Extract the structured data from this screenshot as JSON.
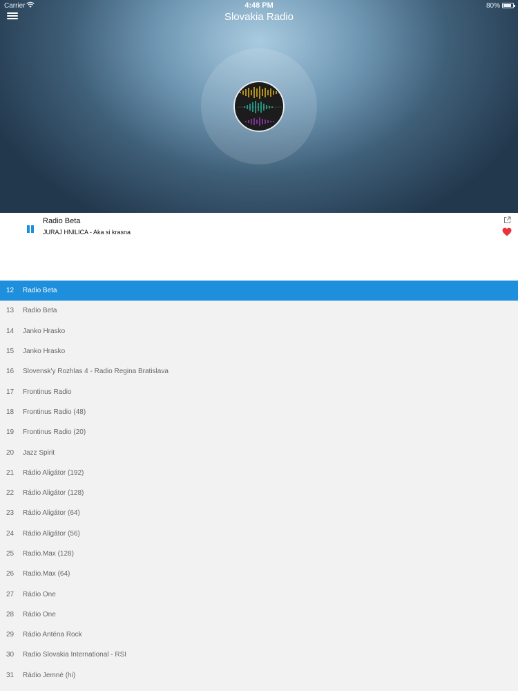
{
  "status_bar": {
    "carrier": "Carrier",
    "time": "4:48 PM",
    "battery": "80%"
  },
  "header": {
    "title": "Slovakia Radio",
    "menu_icon": "hamburger-menu-icon"
  },
  "now_playing": {
    "station": "Radio Beta",
    "track": "JURAJ HNILICA - Aka si krasna",
    "accent_color": "#1d8fdc",
    "favorite_color": "#e8343f"
  },
  "stations": [
    {
      "num": "12",
      "name": "Radio Beta",
      "active": true
    },
    {
      "num": "13",
      "name": "Radio Beta"
    },
    {
      "num": "14",
      "name": "Janko Hrasko"
    },
    {
      "num": "15",
      "name": "Janko Hrasko"
    },
    {
      "num": "16",
      "name": "Slovensk'y Rozhlas 4 - Radio Regina Bratislava"
    },
    {
      "num": "17",
      "name": "Frontinus Radio"
    },
    {
      "num": "18",
      "name": "Frontinus Radio (48)"
    },
    {
      "num": "19",
      "name": "Frontinus Radio (20)"
    },
    {
      "num": "20",
      "name": "Jazz Spirit"
    },
    {
      "num": "21",
      "name": "Rádio Aligátor (192)"
    },
    {
      "num": "22",
      "name": "Rádio Aligátor (128)"
    },
    {
      "num": "23",
      "name": "Rádio Aligátor (64)"
    },
    {
      "num": "24",
      "name": "Rádio Aligátor (56)"
    },
    {
      "num": "25",
      "name": "Radio.Max (128)"
    },
    {
      "num": "26",
      "name": "Radio.Max (64)"
    },
    {
      "num": "27",
      "name": "Rádio One"
    },
    {
      "num": "28",
      "name": "Rádio One"
    },
    {
      "num": "29",
      "name": "Rádio Anténa Rock"
    },
    {
      "num": "30",
      "name": "Radio Slovakia International - RSI"
    },
    {
      "num": "31",
      "name": "Rádio Jemné (hi)"
    }
  ]
}
